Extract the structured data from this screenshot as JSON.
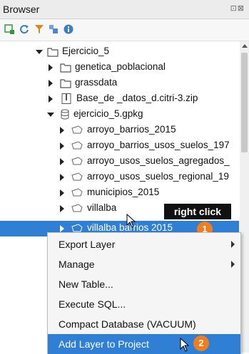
{
  "panel": {
    "title": "Browser",
    "window_buttons": "⊡⊠"
  },
  "toolbar": {
    "icons": [
      "add-layer-icon",
      "refresh-icon",
      "filter-icon",
      "collapse-all-icon",
      "info-icon"
    ]
  },
  "tree": {
    "items": [
      {
        "label": "Ejercicio_5",
        "type": "folder",
        "expanded": true
      },
      {
        "label": "genetica_poblacional",
        "type": "folder"
      },
      {
        "label": "grassdata",
        "type": "folder"
      },
      {
        "label": "Base_de _datos_d.citri-3.zip",
        "type": "zip"
      },
      {
        "label": "ejercicio_5.gpkg",
        "type": "database",
        "expanded": true
      },
      {
        "label": "arroyo_barrios_2015",
        "type": "layer"
      },
      {
        "label": "arroyo_barrios_usos_suelos_197",
        "type": "layer"
      },
      {
        "label": "arroyo_usos_suelos_agregados_",
        "type": "layer"
      },
      {
        "label": "arroyo_usos_suelos_regional_19",
        "type": "layer"
      },
      {
        "label": "municipios_2015",
        "type": "layer"
      },
      {
        "label": "villalba",
        "type": "layer"
      },
      {
        "label": "villalba barrios 2015",
        "type": "layer",
        "selected": true
      }
    ]
  },
  "annotations": {
    "right_click_label": "right click",
    "step1": "1",
    "step2": "2"
  },
  "context_menu": {
    "items": [
      {
        "label": "Export Layer",
        "submenu": true
      },
      {
        "label": "Manage",
        "submenu": true
      },
      {
        "label": "New Table..."
      },
      {
        "label": "Execute SQL..."
      },
      {
        "label": "Compact Database (VACUUM)"
      },
      {
        "label": "Add Layer to Project",
        "highlighted": true
      }
    ]
  },
  "colors": {
    "selection": "#2f7fd4",
    "badge": "#f07e1e",
    "callout": "#111111"
  }
}
